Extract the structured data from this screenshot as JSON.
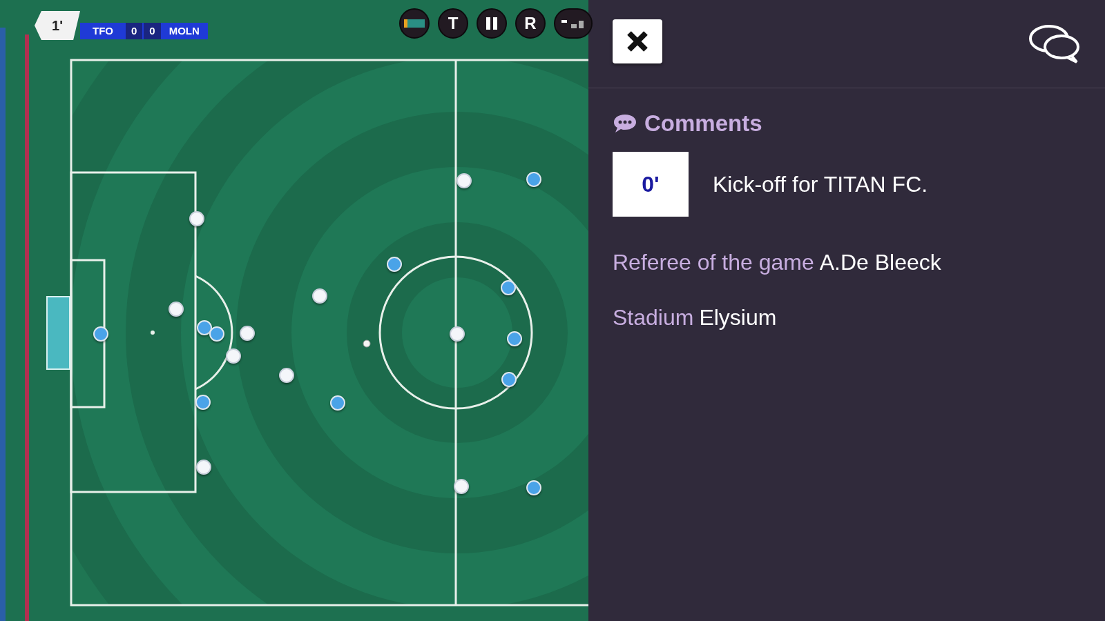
{
  "match_bar": {
    "minute": "1'",
    "home_team": "TFO",
    "home_score": "0",
    "away_score": "0",
    "away_team": "MOLN"
  },
  "controls": [
    {
      "kind": "tactics"
    },
    {
      "kind": "letter",
      "label": "T"
    },
    {
      "kind": "pause"
    },
    {
      "kind": "letter",
      "label": "R"
    },
    {
      "kind": "volume"
    }
  ],
  "pitch": {
    "players": [
      {
        "kind": "home"
      },
      {
        "kind": "home"
      },
      {
        "kind": "home"
      },
      {
        "kind": "home"
      },
      {
        "kind": "home"
      },
      {
        "kind": "home"
      },
      {
        "kind": "home"
      },
      {
        "kind": "home"
      },
      {
        "kind": "home"
      },
      {
        "kind": "home"
      },
      {
        "kind": "away"
      },
      {
        "kind": "away"
      },
      {
        "kind": "away"
      },
      {
        "kind": "away"
      },
      {
        "kind": "away"
      },
      {
        "kind": "away"
      },
      {
        "kind": "away"
      },
      {
        "kind": "away"
      },
      {
        "kind": "away"
      },
      {
        "kind": "away"
      },
      {
        "kind": "away"
      }
    ]
  },
  "panel": {
    "title": "Comments",
    "comments": [
      {
        "minute": "0'",
        "text": "Kick-off for TITAN FC."
      }
    ],
    "details": [
      {
        "label": "Referee of the game",
        "value": "A.De Bleeck"
      },
      {
        "label": "Stadium",
        "value": "Elysium"
      }
    ]
  }
}
